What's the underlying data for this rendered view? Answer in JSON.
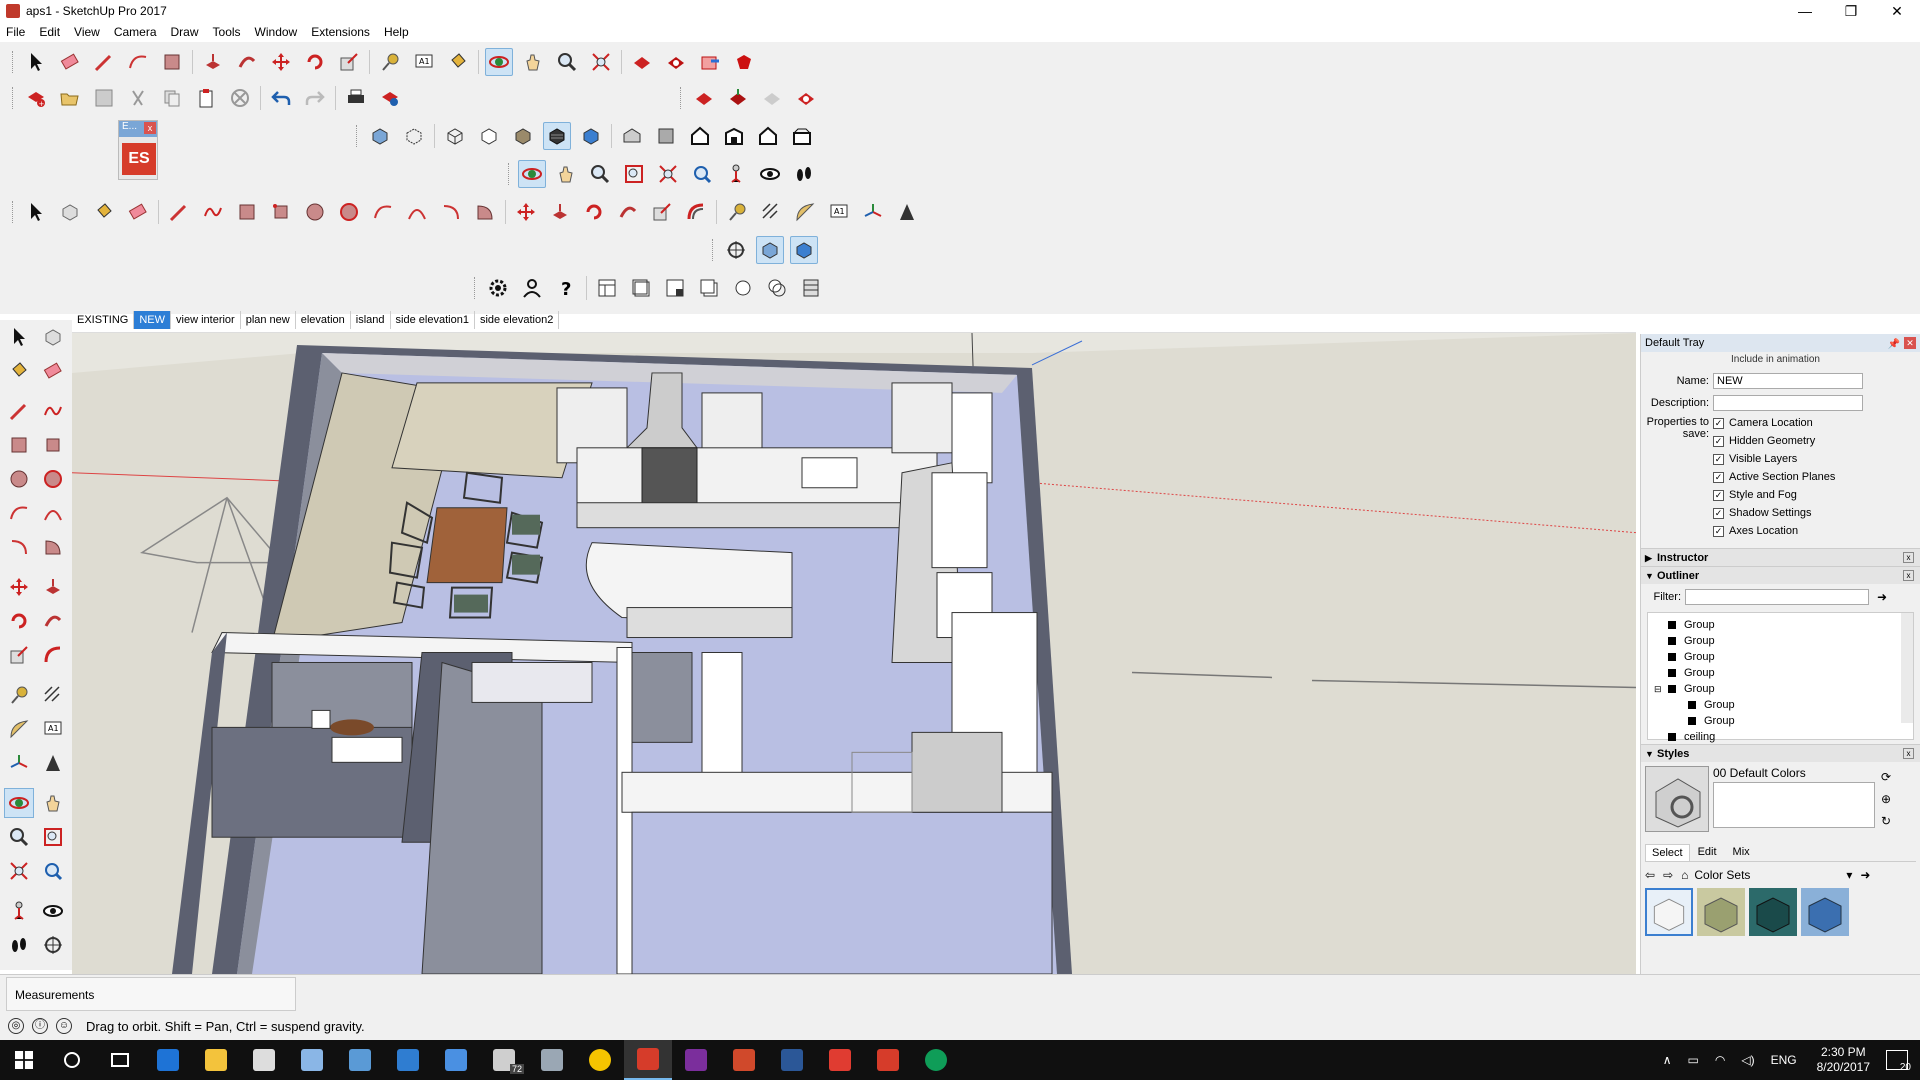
{
  "window": {
    "title": "aps1 - SketchUp Pro 2017",
    "minimize": "—",
    "maximize": "❐",
    "close": "✕"
  },
  "menu": [
    "File",
    "Edit",
    "View",
    "Camera",
    "Draw",
    "Tools",
    "Window",
    "Extensions",
    "Help"
  ],
  "es_panel": {
    "title": "E...",
    "button": "ES",
    "close": "x"
  },
  "scenes": {
    "tabs": [
      "EXISTING",
      "NEW",
      "view interior",
      "plan new",
      "elevation",
      "island",
      "side elevation1",
      "side elevation2"
    ],
    "active": "NEW"
  },
  "tray": {
    "title": "Default Tray",
    "scene_props": {
      "truncated_label": "Include in animation",
      "name_label": "Name:",
      "name_value": "NEW",
      "description_label": "Description:",
      "description_value": "",
      "properties_label": "Properties to save:",
      "properties": [
        "Camera Location",
        "Hidden Geometry",
        "Visible Layers",
        "Active Section Planes",
        "Style and Fog",
        "Shadow Settings",
        "Axes Location"
      ]
    },
    "instructor": {
      "title": "Instructor"
    },
    "outliner": {
      "title": "Outliner",
      "filter_label": "Filter:",
      "filter_value": "",
      "items": [
        {
          "label": "Group",
          "indent": 0
        },
        {
          "label": "Group",
          "indent": 0
        },
        {
          "label": "Group",
          "indent": 0
        },
        {
          "label": "Group",
          "indent": 0
        },
        {
          "label": "Group",
          "indent": 0
        },
        {
          "label": "Group",
          "indent": 1
        },
        {
          "label": "Group",
          "indent": 1
        },
        {
          "label": "ceiling",
          "indent": 0
        }
      ]
    },
    "styles": {
      "title": "Styles",
      "style_name": "00  Default Colors",
      "tabs": [
        "Select",
        "Edit",
        "Mix"
      ],
      "active_tab": "Select",
      "collection": "Color Sets"
    }
  },
  "measurements": {
    "label": "Measurements"
  },
  "status": {
    "text": "Drag to orbit. Shift = Pan, Ctrl = suspend gravity."
  },
  "taskbar": {
    "language": "ENG",
    "time": "2:30 PM",
    "date": "8/20/2017",
    "notifications": "20",
    "mail_badge": "72"
  },
  "colors": {
    "floor": "#b9bfe3",
    "wall_dark": "#5c6070",
    "accent": "#2c7ed6",
    "table": "#a0623a"
  }
}
